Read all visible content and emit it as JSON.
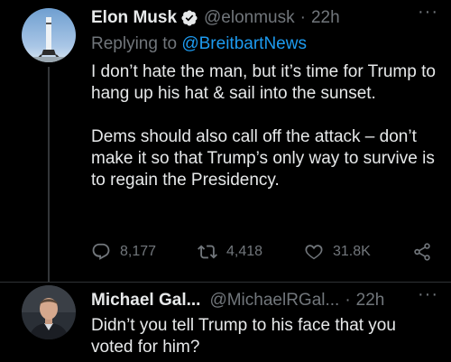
{
  "tweets": [
    {
      "display_name": "Elon Musk",
      "handle": "@elonmusk",
      "sep": "·",
      "time": "22h",
      "more": "···",
      "replying_prefix": "Replying to",
      "replying_mention": "@BreitbartNews",
      "paragraphs": [
        "I don’t hate the man, but it’s time for Trump to hang up his hat & sail into the sunset.",
        "Dems should also call off the attack – don’t make it so that Trump’s only way to survive is to regain the Presidency."
      ],
      "stats": {
        "replies": "8,177",
        "retweets": "4,418",
        "likes": "31.8K"
      },
      "icons": [
        "verified-badge-icon",
        "reply-icon",
        "retweet-icon",
        "like-icon",
        "share-icon"
      ],
      "colors": {
        "verified": "#1d9bf0",
        "link": "#1d9bf0"
      }
    },
    {
      "display_name": "Michael Gal...",
      "handle": "@MichaelRGal...",
      "sep": "·",
      "time": "22h",
      "more": "···",
      "paragraphs": [
        "Didn’t you tell Trump to his face that you voted for him?"
      ]
    }
  ]
}
